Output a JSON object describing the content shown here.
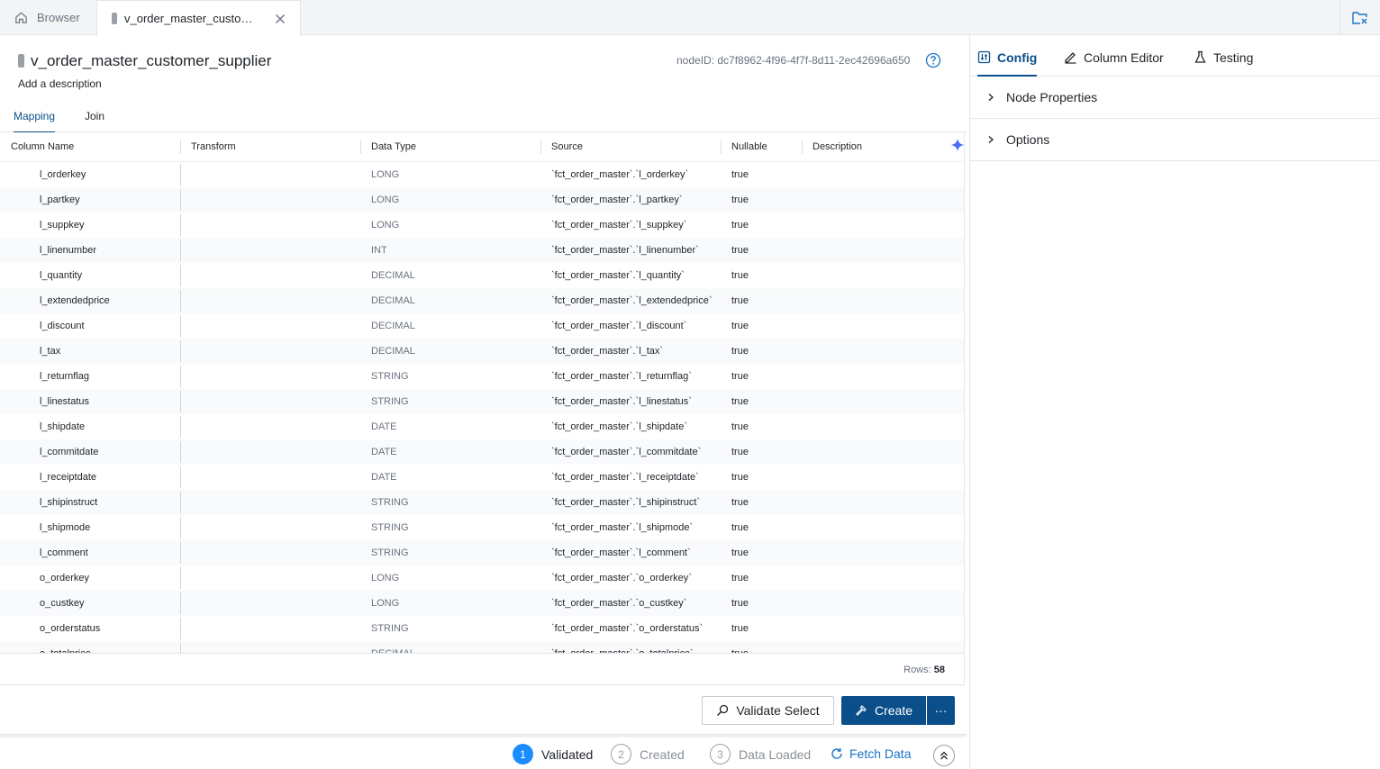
{
  "tabs": {
    "browser_label": "Browser",
    "active_label": "v_order_master_customer_supplier"
  },
  "node": {
    "title": "v_order_master_customer_supplier",
    "node_id": "nodeID: dc7f8962-4f96-4f7f-8d11-2ec42696a650",
    "add_description": "Add a description"
  },
  "subtabs": {
    "mapping": "Mapping",
    "join": "Join"
  },
  "table": {
    "headers": {
      "column_name": "Column Name",
      "transform": "Transform",
      "data_type": "Data Type",
      "source": "Source",
      "nullable": "Nullable",
      "description": "Description"
    },
    "rows": [
      {
        "name": "l_orderkey",
        "type": "LONG",
        "source": "`fct_order_master`.`l_orderkey`",
        "nullable": "true"
      },
      {
        "name": "l_partkey",
        "type": "LONG",
        "source": "`fct_order_master`.`l_partkey`",
        "nullable": "true"
      },
      {
        "name": "l_suppkey",
        "type": "LONG",
        "source": "`fct_order_master`.`l_suppkey`",
        "nullable": "true"
      },
      {
        "name": "l_linenumber",
        "type": "INT",
        "source": "`fct_order_master`.`l_linenumber`",
        "nullable": "true"
      },
      {
        "name": "l_quantity",
        "type": "DECIMAL",
        "source": "`fct_order_master`.`l_quantity`",
        "nullable": "true"
      },
      {
        "name": "l_extendedprice",
        "type": "DECIMAL",
        "source": "`fct_order_master`.`l_extendedprice`",
        "nullable": "true"
      },
      {
        "name": "l_discount",
        "type": "DECIMAL",
        "source": "`fct_order_master`.`l_discount`",
        "nullable": "true"
      },
      {
        "name": "l_tax",
        "type": "DECIMAL",
        "source": "`fct_order_master`.`l_tax`",
        "nullable": "true"
      },
      {
        "name": "l_returnflag",
        "type": "STRING",
        "source": "`fct_order_master`.`l_returnflag`",
        "nullable": "true"
      },
      {
        "name": "l_linestatus",
        "type": "STRING",
        "source": "`fct_order_master`.`l_linestatus`",
        "nullable": "true"
      },
      {
        "name": "l_shipdate",
        "type": "DATE",
        "source": "`fct_order_master`.`l_shipdate`",
        "nullable": "true"
      },
      {
        "name": "l_commitdate",
        "type": "DATE",
        "source": "`fct_order_master`.`l_commitdate`",
        "nullable": "true"
      },
      {
        "name": "l_receiptdate",
        "type": "DATE",
        "source": "`fct_order_master`.`l_receiptdate`",
        "nullable": "true"
      },
      {
        "name": "l_shipinstruct",
        "type": "STRING",
        "source": "`fct_order_master`.`l_shipinstruct`",
        "nullable": "true"
      },
      {
        "name": "l_shipmode",
        "type": "STRING",
        "source": "`fct_order_master`.`l_shipmode`",
        "nullable": "true"
      },
      {
        "name": "l_comment",
        "type": "STRING",
        "source": "`fct_order_master`.`l_comment`",
        "nullable": "true"
      },
      {
        "name": "o_orderkey",
        "type": "LONG",
        "source": "`fct_order_master`.`o_orderkey`",
        "nullable": "true"
      },
      {
        "name": "o_custkey",
        "type": "LONG",
        "source": "`fct_order_master`.`o_custkey`",
        "nullable": "true"
      },
      {
        "name": "o_orderstatus",
        "type": "STRING",
        "source": "`fct_order_master`.`o_orderstatus`",
        "nullable": "true"
      },
      {
        "name": "o_totalprice",
        "type": "DECIMAL",
        "source": "`fct_order_master`.`o_totalprice`",
        "nullable": "true"
      }
    ],
    "rows_label": "Rows:",
    "rows_count": "58"
  },
  "actions": {
    "validate_label": "Validate Select",
    "create_label": "Create",
    "more_label": "···"
  },
  "status": {
    "steps": [
      {
        "num": "1",
        "label": "Validated"
      },
      {
        "num": "2",
        "label": "Created"
      },
      {
        "num": "3",
        "label": "Data Loaded"
      }
    ],
    "fetch_label": "Fetch Data"
  },
  "right_panel": {
    "tabs": [
      "Config",
      "Column Editor",
      "Testing"
    ],
    "sections": [
      "Node Properties",
      "Options"
    ]
  },
  "colors": {
    "accent": "#0b4f8a",
    "step_active": "#1a8cff",
    "link": "#1a73c7"
  }
}
